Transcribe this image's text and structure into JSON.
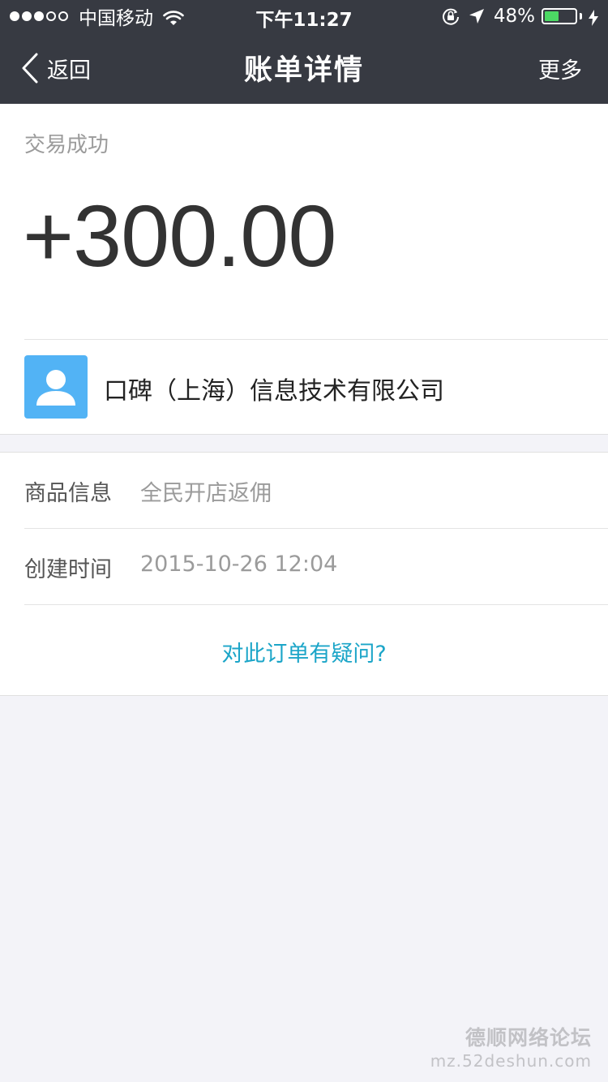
{
  "status_bar": {
    "carrier": "中国移动",
    "time": "下午11:27",
    "battery": "48%",
    "battery_level": 0.48,
    "signal_strength": 3,
    "signal_max": 5,
    "icons": [
      "wifi-icon",
      "orientation-lock-icon",
      "location-arrow-icon",
      "battery-icon",
      "charging-bolt-icon"
    ]
  },
  "nav": {
    "back_label": "返回",
    "title": "账单详情",
    "more_label": "更多",
    "icons": [
      "chevron-left-icon"
    ]
  },
  "transaction": {
    "status": "交易成功",
    "amount": "+300.00"
  },
  "merchant": {
    "name": "口碑（上海）信息技术有限公司",
    "avatar_icon": "user-avatar-icon",
    "avatar_color": "#52b3f5"
  },
  "details": {
    "product_label": "商品信息",
    "product_value": "全民开店返佣",
    "created_label": "创建时间",
    "created_value": "2015-10-26 12:04"
  },
  "question_link": "对此订单有疑问?",
  "colors": {
    "header_bg": "#373a42",
    "page_bg": "#f3f3f8",
    "link": "#1ba5c8",
    "battery_green": "#4cd964"
  },
  "watermark": {
    "title": "德顺网络论坛",
    "url": "mz.52deshun.com"
  }
}
